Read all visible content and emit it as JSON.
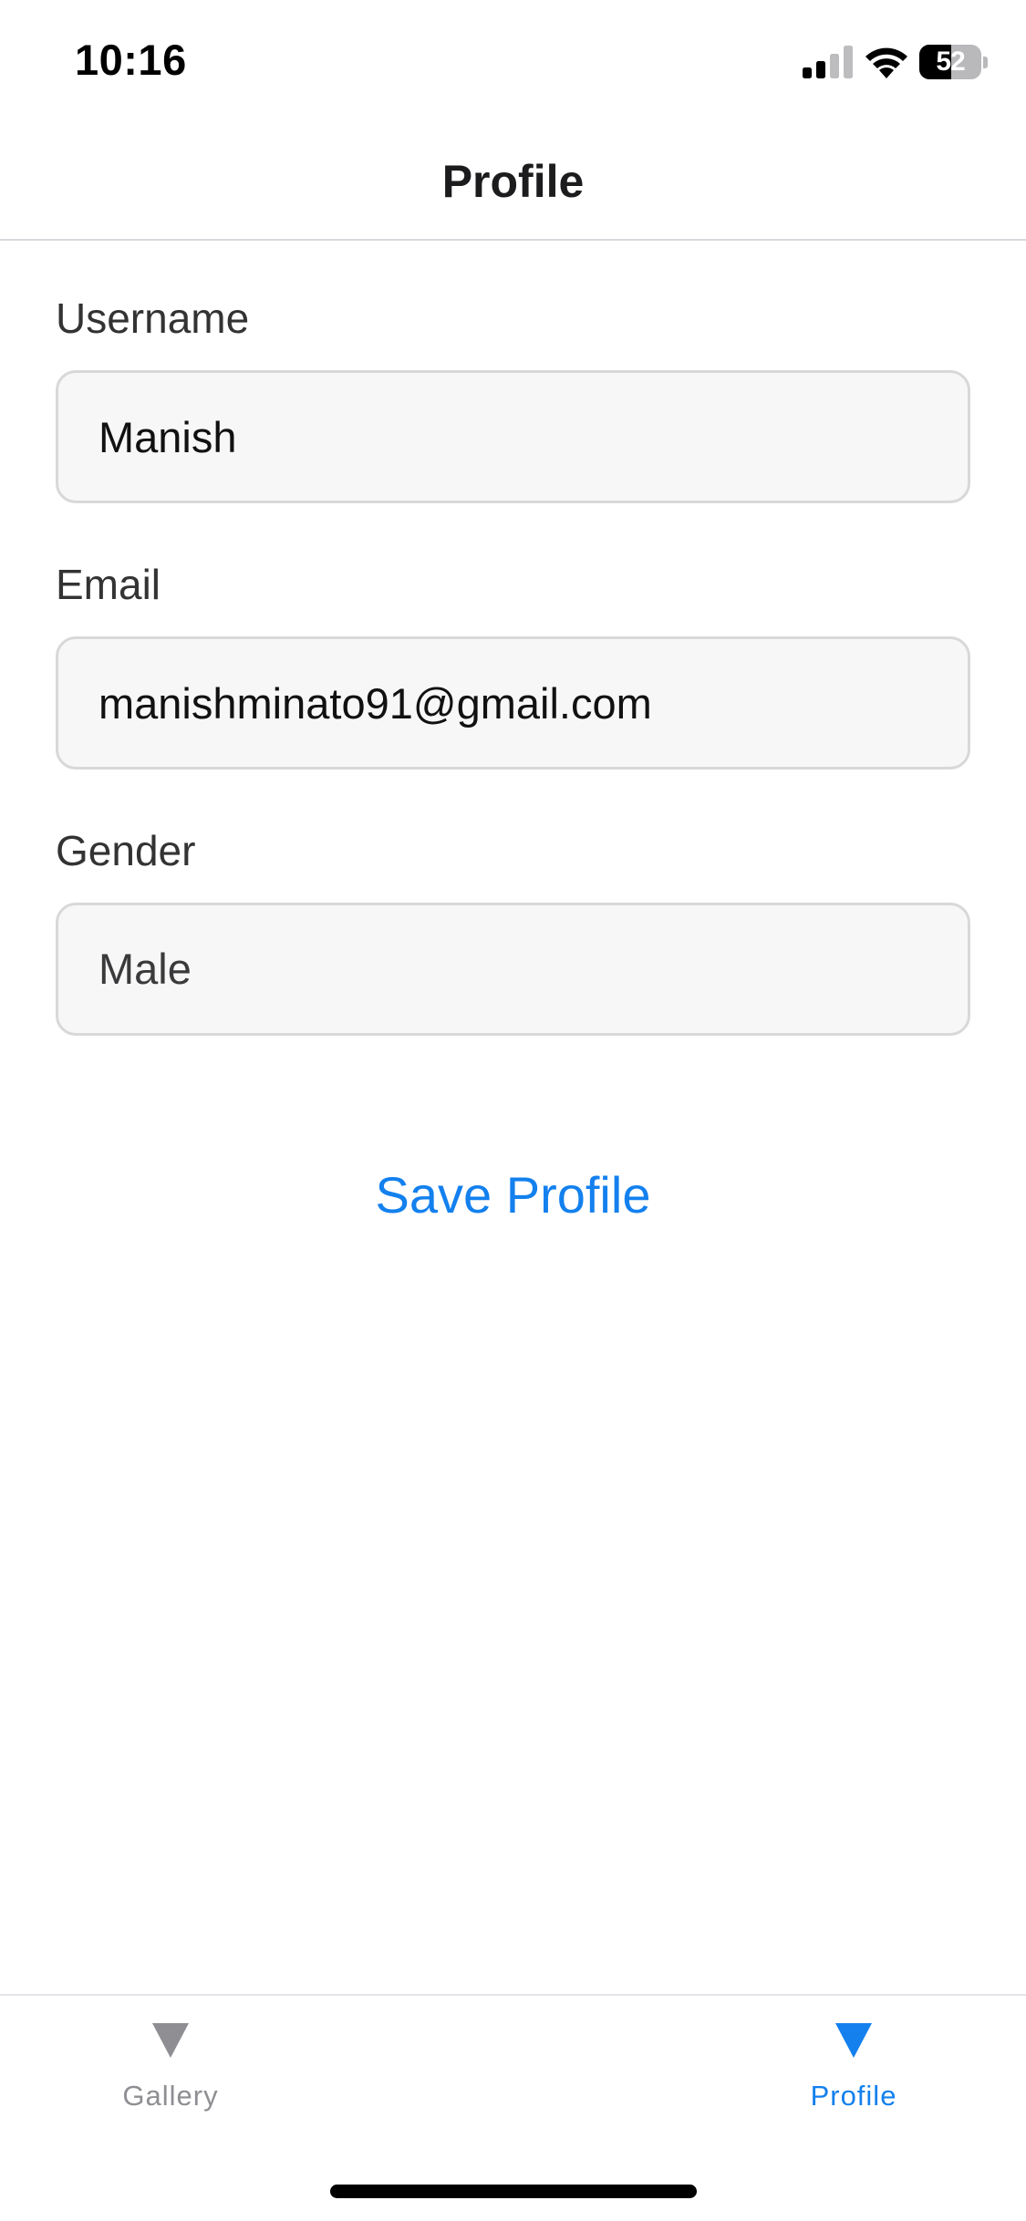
{
  "status_bar": {
    "time": "10:16",
    "battery_level": "52"
  },
  "nav": {
    "title": "Profile"
  },
  "form": {
    "username": {
      "label": "Username",
      "value": "Manish"
    },
    "email": {
      "label": "Email",
      "value": "manishminato91@gmail.com"
    },
    "gender": {
      "label": "Gender",
      "value": "Male"
    },
    "save_label": "Save Profile"
  },
  "tab_bar": {
    "items": [
      {
        "label": "Gallery",
        "icon": "triangle-down-icon",
        "active": false
      },
      {
        "label": "Profile",
        "icon": "triangle-down-icon",
        "active": true
      }
    ]
  },
  "colors": {
    "accent": "#1380ee",
    "inactive": "#8e8e93",
    "field_background": "#f7f7f7",
    "field_border": "#d8d8d8"
  }
}
